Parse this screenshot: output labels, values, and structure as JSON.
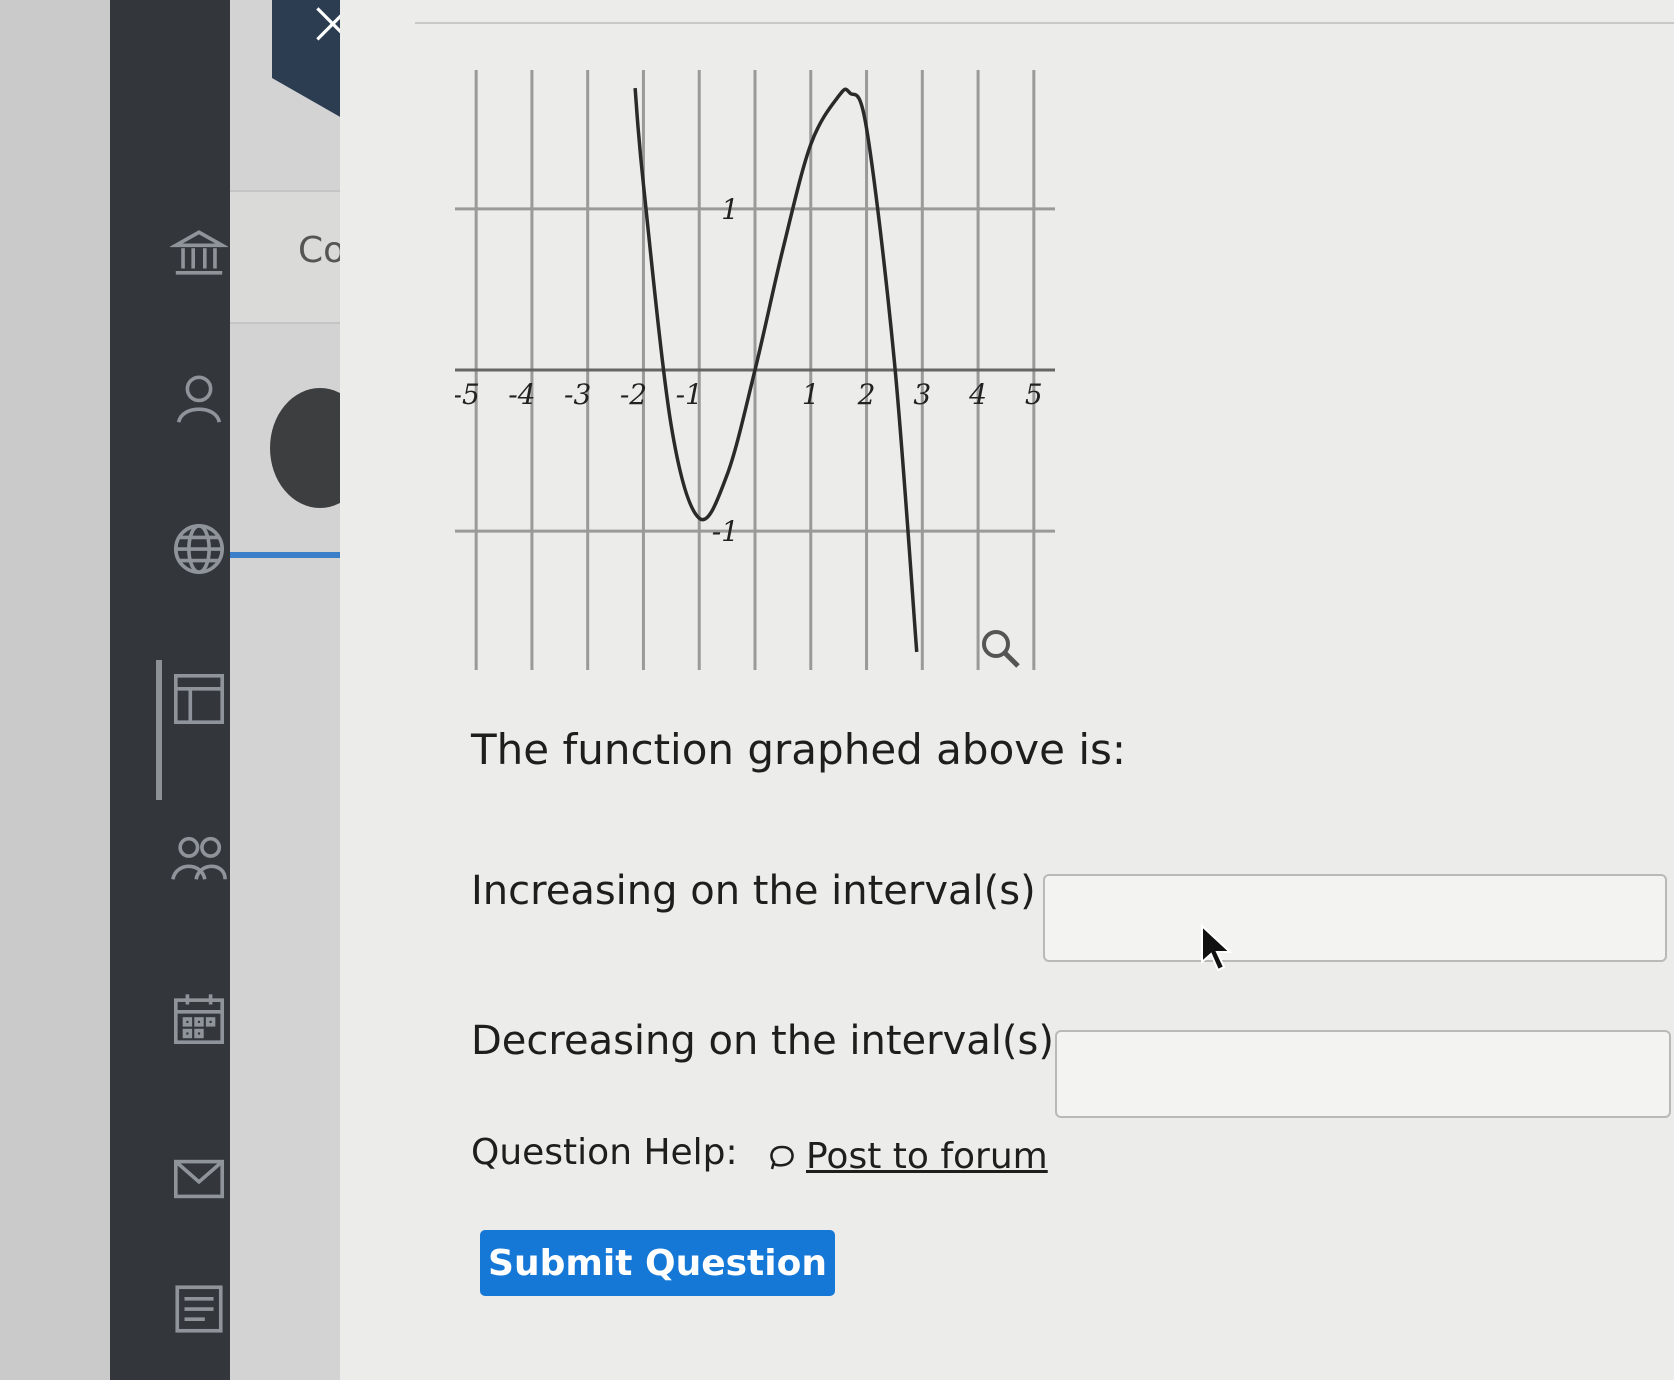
{
  "close_tab": {
    "glyph": "×"
  },
  "panel": {
    "title_fragment": "Co"
  },
  "graph": {
    "x_ticks": [
      "-5",
      "-4",
      "-3",
      "-2",
      "-1",
      "1",
      "2",
      "3",
      "4",
      "5"
    ],
    "y_ticks": [
      "1",
      "-1"
    ]
  },
  "chart_data": {
    "type": "line",
    "title": "",
    "xlabel": "",
    "ylabel": "",
    "xlim": [
      -5.2,
      5.2
    ],
    "ylim": [
      -1.8,
      1.8
    ],
    "grid": true,
    "series": [
      {
        "x": [
          -2.15,
          -2.0,
          -1.5,
          -1.0,
          -0.5,
          0,
          0.5,
          1.0,
          1.5,
          1.7,
          2.0,
          2.5,
          2.9
        ],
        "y": [
          1.75,
          1.15,
          -0.35,
          -0.92,
          -0.65,
          0.0,
          0.75,
          1.4,
          1.7,
          1.72,
          1.5,
          0.05,
          -1.75
        ]
      }
    ]
  },
  "prompt": "The function graphed above is:",
  "questions": {
    "increasing_label": "Increasing on the interval(s)",
    "increasing_value": "",
    "decreasing_label": "Decreasing on the interval(s)",
    "decreasing_value": ""
  },
  "help": {
    "label": "Question Help:",
    "forum_link": "Post to forum"
  },
  "submit": {
    "label": "Submit Question"
  },
  "colors": {
    "sidebar": "#33373c",
    "submit_button": "#1578d6",
    "accent_line": "#3a7fc8"
  }
}
